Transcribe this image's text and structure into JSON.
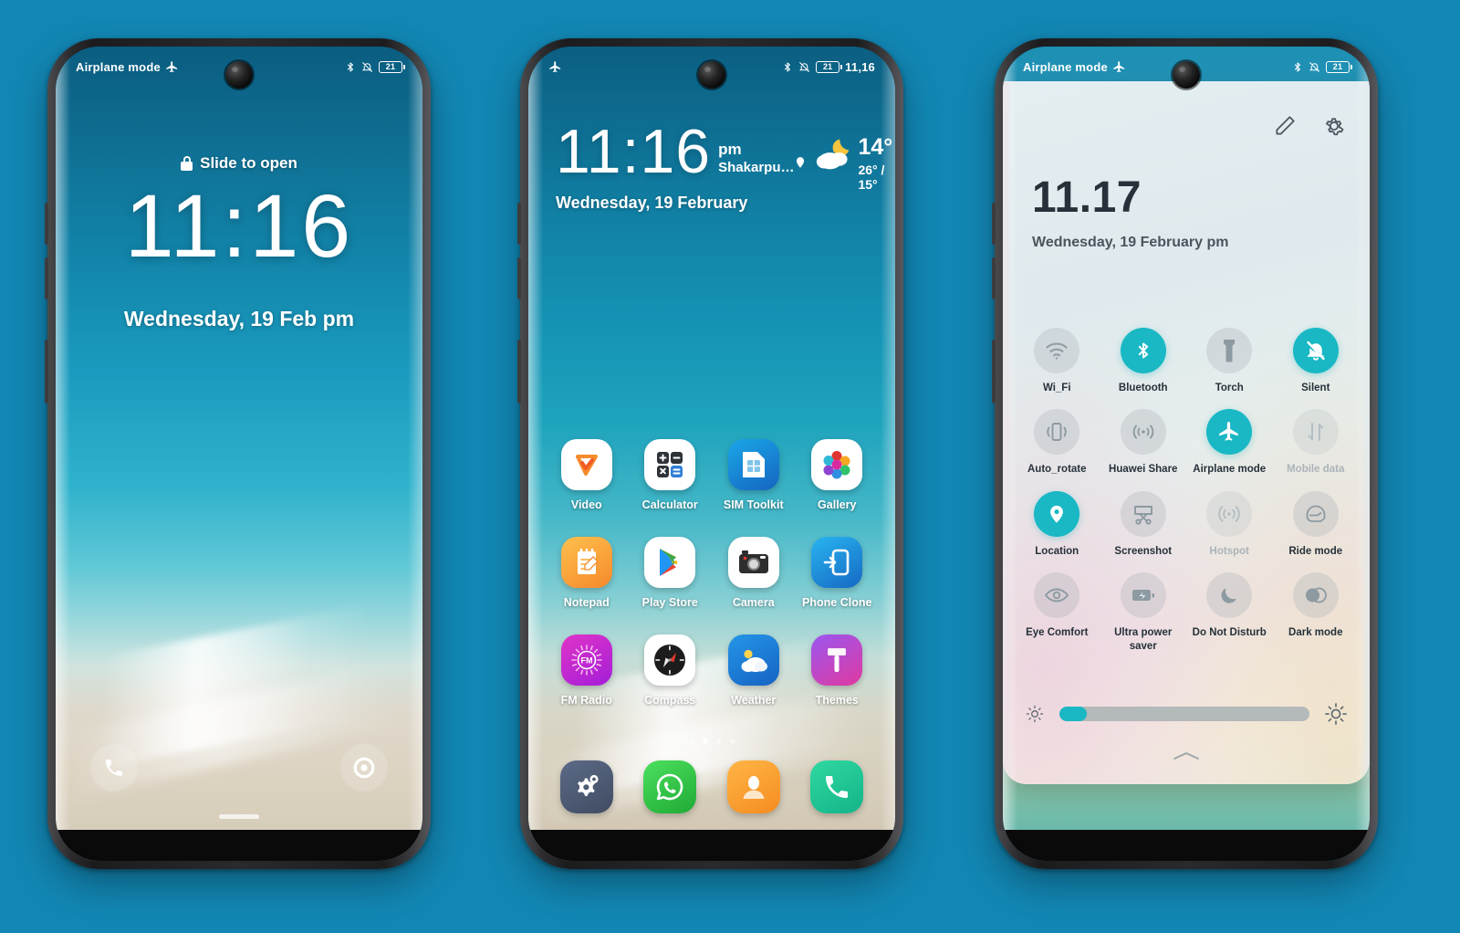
{
  "theme": {
    "page_background": "#1287b4",
    "accent": "#19b8c4",
    "tile_off": "#a0aaaf",
    "qs_text": "#26313a"
  },
  "phones": {
    "lock_screen": {
      "status_bar": {
        "left_text": "Airplane mode",
        "left_icon": "airplane-icon",
        "icons": [
          "bluetooth-icon",
          "mute-icon"
        ],
        "battery_level": "21"
      },
      "slide_hint": "Slide to open",
      "lock_icon": "lock-icon",
      "clock": "11:16",
      "date": "Wednesday, 19 Feb pm",
      "shortcuts": [
        {
          "name": "phone-shortcut",
          "icon": "phone-icon"
        },
        {
          "name": "camera-shortcut",
          "icon": "camera-shutter-icon"
        }
      ]
    },
    "home_screen": {
      "status_bar": {
        "left_icon": "airplane-icon",
        "icons": [
          "bluetooth-icon",
          "mute-icon"
        ],
        "battery_level": "21",
        "time": "11,16"
      },
      "widget": {
        "clock": "11:16",
        "ampm": "pm",
        "location": "Shakarpu…",
        "location_pin_icon": "location-pin-icon",
        "date": "Wednesday, 19 February",
        "weather_icon": "moon-cloud-icon",
        "temperature": "14°",
        "high_low": "26° / 15°"
      },
      "apps": [
        {
          "label": "Video",
          "icon": "video-icon"
        },
        {
          "label": "Calculator",
          "icon": "calculator-icon"
        },
        {
          "label": "SIM Toolkit",
          "icon": "sim-card-icon"
        },
        {
          "label": "Gallery",
          "icon": "gallery-icon"
        },
        {
          "label": "Notepad",
          "icon": "notepad-icon"
        },
        {
          "label": "Play Store",
          "icon": "play-store-icon"
        },
        {
          "label": "Camera",
          "icon": "camera-icon"
        },
        {
          "label": "Phone Clone",
          "icon": "phone-clone-icon"
        },
        {
          "label": "FM Radio",
          "icon": "fm-radio-icon"
        },
        {
          "label": "Compass",
          "icon": "compass-icon"
        },
        {
          "label": "Weather",
          "icon": "weather-icon"
        },
        {
          "label": "Themes",
          "icon": "themes-icon"
        }
      ],
      "page_indicator": {
        "pages": 4,
        "active": 1
      },
      "dock": [
        {
          "label": "Settings",
          "icon": "settings-gear-icon"
        },
        {
          "label": "WhatsApp",
          "icon": "whatsapp-icon"
        },
        {
          "label": "Contacts",
          "icon": "contacts-icon"
        },
        {
          "label": "Phone",
          "icon": "phone-handset-icon"
        }
      ]
    },
    "quick_settings": {
      "status_bar": {
        "left_text": "Airplane mode",
        "left_icon": "airplane-icon",
        "icons": [
          "bluetooth-icon",
          "mute-icon"
        ],
        "battery_level": "21"
      },
      "header_actions": [
        {
          "name": "edit-button",
          "icon": "pencil-icon"
        },
        {
          "name": "settings-button",
          "icon": "gear-icon"
        }
      ],
      "clock": "11.17",
      "date": "Wednesday, 19 February  pm",
      "tiles": [
        {
          "label": "Wi_Fi",
          "icon": "wifi-icon",
          "state": "off"
        },
        {
          "label": "Bluetooth",
          "icon": "bluetooth-icon",
          "state": "on"
        },
        {
          "label": "Torch",
          "icon": "flashlight-icon",
          "state": "off"
        },
        {
          "label": "Silent",
          "icon": "bell-mute-icon",
          "state": "on"
        },
        {
          "label": "Auto_rotate",
          "icon": "auto-rotate-icon",
          "state": "off"
        },
        {
          "label": "Huawei Share",
          "icon": "share-waves-icon",
          "state": "off"
        },
        {
          "label": "Airplane mode",
          "icon": "airplane-icon",
          "state": "on"
        },
        {
          "label": "Mobile data",
          "icon": "data-arrows-icon",
          "state": "disabled"
        },
        {
          "label": "Location",
          "icon": "location-pin-icon",
          "state": "on"
        },
        {
          "label": "Screenshot",
          "icon": "screenshot-icon",
          "state": "off"
        },
        {
          "label": "Hotspot",
          "icon": "hotspot-icon",
          "state": "disabled"
        },
        {
          "label": "Ride mode",
          "icon": "helmet-icon",
          "state": "off"
        },
        {
          "label": "Eye Comfort",
          "icon": "eye-icon",
          "state": "off"
        },
        {
          "label": "Ultra power saver",
          "icon": "battery-bolt-icon",
          "state": "off"
        },
        {
          "label": "Do Not Disturb",
          "icon": "moon-icon",
          "state": "off"
        },
        {
          "label": "Dark mode",
          "icon": "contrast-icon",
          "state": "off"
        }
      ],
      "brightness": {
        "low_icon": "brightness-low-icon",
        "high_icon": "brightness-high-icon",
        "value_percent": 11
      },
      "collapse_handle_icon": "chevron-up-icon"
    }
  }
}
